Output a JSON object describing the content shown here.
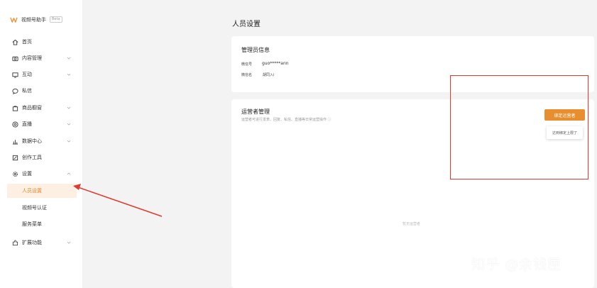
{
  "sidebar": {
    "brand": {
      "name": "视频号助手",
      "tag": "Beta"
    },
    "items": [
      {
        "label": "首页",
        "icon": "home-icon",
        "has_chevron": false
      },
      {
        "label": "内容管理",
        "icon": "camera-icon",
        "has_chevron": true
      },
      {
        "label": "互动",
        "icon": "monitor-icon",
        "has_chevron": true
      },
      {
        "label": "私信",
        "icon": "chat-icon",
        "has_chevron": false
      },
      {
        "label": "商品橱窗",
        "icon": "bag-icon",
        "has_chevron": true
      },
      {
        "label": "直播",
        "icon": "live-icon",
        "has_chevron": true
      },
      {
        "label": "数据中心",
        "icon": "chart-icon",
        "has_chevron": true
      },
      {
        "label": "创作工具",
        "icon": "tool-icon",
        "has_chevron": false
      },
      {
        "label": "设置",
        "icon": "gear-icon",
        "has_chevron": true
      }
    ],
    "settings_sub": [
      {
        "label": "人员设置",
        "active": true
      },
      {
        "label": "视频号认证",
        "active": false
      },
      {
        "label": "服务菜单",
        "active": false
      }
    ],
    "extra": {
      "label": "扩展功能",
      "icon": "extension-icon",
      "has_chevron": true
    }
  },
  "main": {
    "page_title": "人员设置",
    "admin_card": {
      "title": "管理员信息",
      "fields": [
        {
          "label": "微信号",
          "value": "guo*****ann"
        },
        {
          "label": "微信名",
          "value": "胡同入i"
        }
      ]
    },
    "ops_card": {
      "title": "运营者管理",
      "hint": "运营者可进行发表、回复、私信、直播等日常运营操作 ⓘ",
      "bind_button": "绑定运营者",
      "tooltip": "达到绑定上限了",
      "empty_text": "暂无运营者"
    }
  },
  "watermark": "知乎 @余钱匣",
  "colors": {
    "accent": "#e88e2f",
    "annotation": "#e03a2f",
    "active_bg": "#fdf0e2"
  }
}
